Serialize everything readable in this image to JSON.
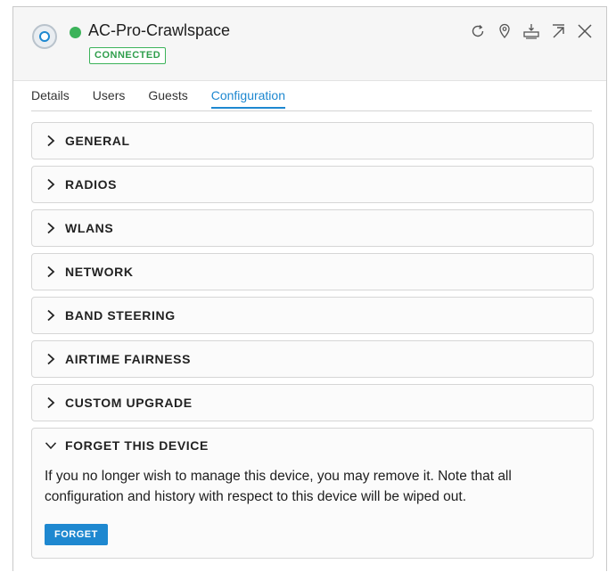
{
  "device": {
    "name": "AC-Pro-Crawlspace",
    "status": "CONNECTED",
    "status_color": "#3cb35a",
    "icon": "access-point-icon"
  },
  "header_actions": [
    {
      "name": "refresh-icon",
      "label": "Refresh"
    },
    {
      "name": "locate-icon",
      "label": "Locate"
    },
    {
      "name": "upgrade-icon",
      "label": "Upgrade"
    },
    {
      "name": "pop-out-icon",
      "label": "Pop out"
    },
    {
      "name": "close-icon",
      "label": "Close"
    }
  ],
  "tabs": [
    {
      "label": "Details",
      "active": false
    },
    {
      "label": "Users",
      "active": false
    },
    {
      "label": "Guests",
      "active": false
    },
    {
      "label": "Configuration",
      "active": true
    }
  ],
  "sections": [
    {
      "title": "GENERAL",
      "expanded": false
    },
    {
      "title": "RADIOS",
      "expanded": false
    },
    {
      "title": "WLANS",
      "expanded": false
    },
    {
      "title": "NETWORK",
      "expanded": false
    },
    {
      "title": "BAND STEERING",
      "expanded": false
    },
    {
      "title": "AIRTIME FAIRNESS",
      "expanded": false
    },
    {
      "title": "CUSTOM UPGRADE",
      "expanded": false
    }
  ],
  "forget_section": {
    "title": "FORGET THIS DEVICE",
    "expanded": true,
    "description": "If you no longer wish to manage this device, you may remove it. Note that all configuration and history with respect to this device will be wiped out.",
    "button_label": "FORGET"
  },
  "colors": {
    "accent": "#1e88d0",
    "connected": "#3cb35a"
  }
}
